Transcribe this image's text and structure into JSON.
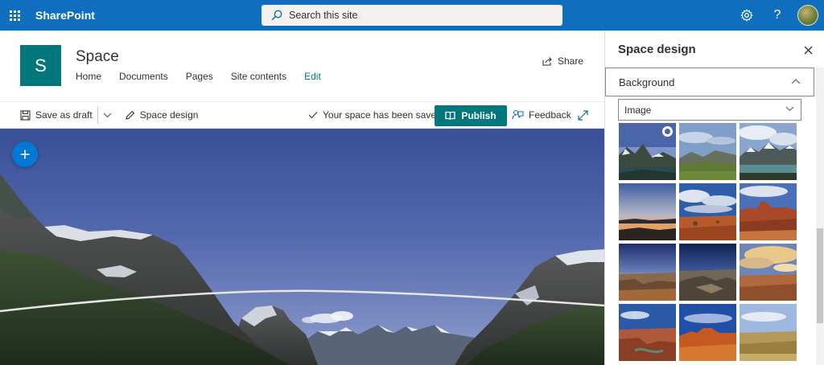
{
  "suitebar": {
    "brand": "SharePoint",
    "search_placeholder": "Search this site",
    "icons": [
      "waffle-icon",
      "search-icon",
      "gear-icon",
      "help-icon",
      "avatar"
    ],
    "bg_color": "#106ebe"
  },
  "site": {
    "logo_letter": "S",
    "title": "Space",
    "nav": [
      "Home",
      "Documents",
      "Pages",
      "Site contents",
      "Edit"
    ],
    "share_label": "Share",
    "accent": "#03787c"
  },
  "cmdbar": {
    "save_label": "Save as draft",
    "space_design_label": "Space design",
    "saved_status": "Your space has been saved",
    "publish_label": "Publish",
    "feedback_label": "Feedback"
  },
  "panel": {
    "title": "Space design",
    "section_label": "Background",
    "dropdown_value": "Image",
    "thumbnails": [
      {
        "name": "glacier-lake-mountains",
        "selected": true
      },
      {
        "name": "green-valley-hills",
        "selected": false
      },
      {
        "name": "mountain-lake-clouds",
        "selected": false
      },
      {
        "name": "sunset-lake",
        "selected": false
      },
      {
        "name": "red-desert-sky",
        "selected": false
      },
      {
        "name": "red-rock-canyon",
        "selected": false
      },
      {
        "name": "grand-canyon-dusk",
        "selected": false
      },
      {
        "name": "canyon-overlook",
        "selected": false
      },
      {
        "name": "desert-cloudy-sky",
        "selected": false
      },
      {
        "name": "canyon-river-bend",
        "selected": false
      },
      {
        "name": "red-mesa-blue-sky",
        "selected": false
      },
      {
        "name": "golden-grassland",
        "selected": false
      }
    ]
  }
}
